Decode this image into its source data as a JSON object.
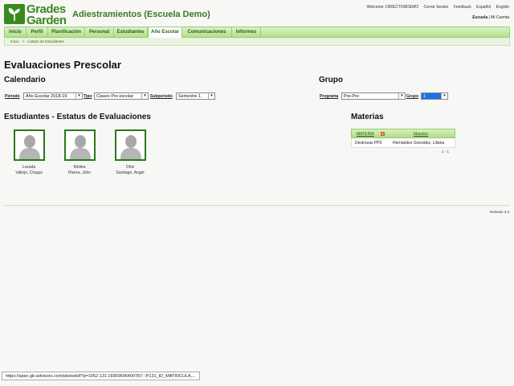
{
  "header": {
    "logo_line1": "Grades",
    "logo_line2": "Garden",
    "app_title": "Adiestramientos (Escuela Demo)",
    "welcome": "Welcome: DIRECTORDEMO",
    "logout": "Cerrar Sesión",
    "feedback": "Feedback",
    "lang_es": "Español",
    "lang_en": "English",
    "school": "Escuela",
    "account": "Mi Cuenta"
  },
  "tabs": [
    {
      "label": "Inicio"
    },
    {
      "label": "Perfil"
    },
    {
      "label": "Planificación"
    },
    {
      "label": "Personal"
    },
    {
      "label": "Estudiantes"
    },
    {
      "label": "Año Escolar"
    },
    {
      "label": "Comunicaciones"
    },
    {
      "label": "Informes"
    }
  ],
  "active_tab": "Año Escolar",
  "breadcrumb": {
    "home": "Inicio",
    "current": "Listado de Estudiantes"
  },
  "page_title": "Evaluaciones Prescolar",
  "calendario": {
    "title": "Calendario",
    "periodo_label": "Periodo",
    "periodo_value": "Año Escolar 2018-19",
    "tipo_label": "Tipo",
    "tipo_value": "Clases Pre escolar",
    "subperiodo_label": "Subperiodo",
    "subperiodo_value": "Semestre 1"
  },
  "grupo": {
    "title": "Grupo",
    "programa_label": "Programa",
    "programa_value": "Pre-Pre",
    "grupo_label": "Grupo",
    "grupo_value": "1"
  },
  "students_title": "Estudiantes - Estatus de Evaluaciones",
  "students": [
    {
      "line1": "Lozada",
      "line2": "Vallejo, Chagui"
    },
    {
      "line1": "Molina",
      "line2": "Rivera, John"
    },
    {
      "line1": "Ortiz",
      "line2": "Santiago, Angel"
    }
  ],
  "materias": {
    "title": "Materias",
    "col_materia": "MATERIA",
    "col_maestro": "Maestro",
    "rows": [
      {
        "materia": "Destrezas PP0",
        "maestro": "Hernández González, Liliana"
      }
    ],
    "pager": "1 - 1"
  },
  "release": "Release 3.3",
  "status_url": "https://apex.gb-advisors.com/pls/web/f?p=1052:131:16959606400787:::P131_ID_MATRICULA,..."
}
